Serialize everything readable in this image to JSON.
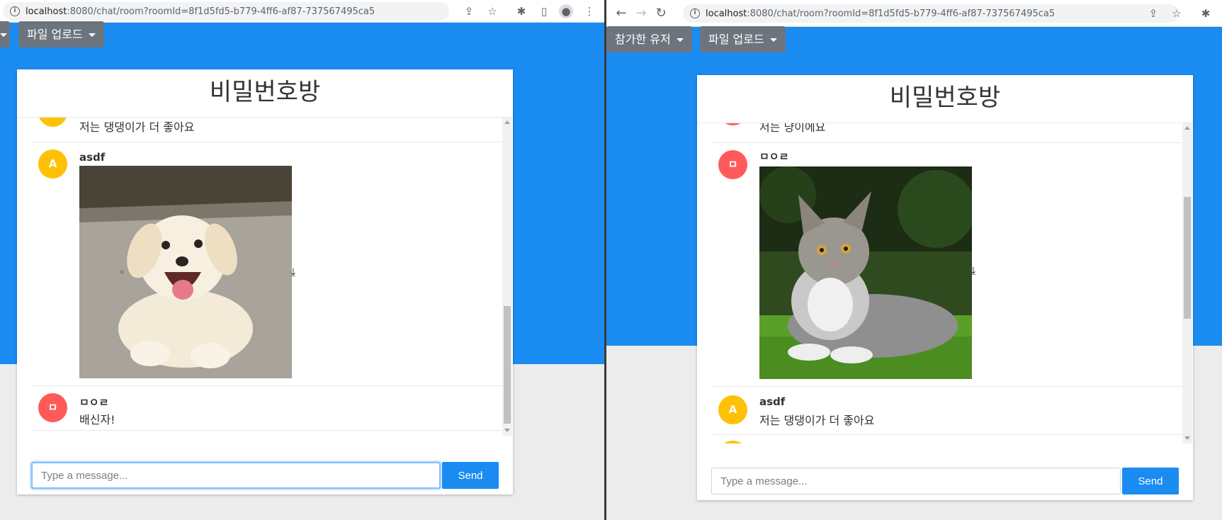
{
  "left": {
    "browser": {
      "url_host": "localhost",
      "url_rest": ":8080/chat/room?roomId=8f1d5fd5-b779-4ff6-af87-737567495ca5"
    },
    "upload_label": "파일 업로드",
    "room_title": "비밀번호방",
    "messages": [
      {
        "initial": "A",
        "text": "저는 댕댕이가 더 좋아요"
      },
      {
        "initial": "A",
        "author": "asdf",
        "image": "puppy-photo"
      },
      {
        "initial": "ㅁ",
        "author": "ㅁㅇㄹ",
        "text": "배신자!"
      }
    ],
    "input_placeholder": "Type a message...",
    "send_label": "Send"
  },
  "right": {
    "browser": {
      "url_host": "localhost",
      "url_rest": ":8080/chat/room?roomId=8f1d5fd5-b779-4ff6-af87-737567495ca5"
    },
    "participants_label": "참가한 유저",
    "upload_label": "파일 업로드",
    "room_title": "비밀번호방",
    "messages": [
      {
        "initial": "ㅁ",
        "text": "저는 냥이에요"
      },
      {
        "initial": "ㅁ",
        "author": "ㅁㅇㄹ",
        "image": "cat-photo"
      },
      {
        "initial": "A",
        "author": "asdf",
        "text": "저는 댕댕이가 더 좋아요"
      }
    ],
    "input_placeholder": "Type a message...",
    "send_label": "Send"
  },
  "colors": {
    "blue": "#1a8cf1",
    "avatar_a": "#ffc107",
    "avatar_m": "#ff5a5a",
    "dropdown": "#6c757d"
  },
  "icons": [
    "info-icon",
    "share-icon",
    "star-icon",
    "extensions-icon",
    "side-panel-icon",
    "profile-icon",
    "menu-icon",
    "back-icon",
    "forward-icon",
    "reload-icon",
    "download-icon"
  ]
}
